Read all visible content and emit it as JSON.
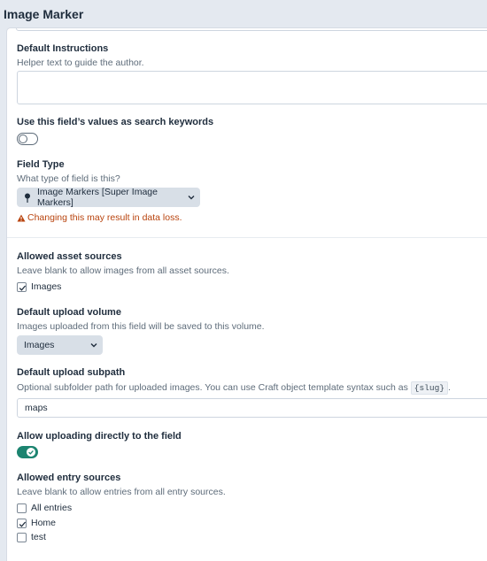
{
  "header": {
    "title": "Image Marker"
  },
  "default_instructions": {
    "label": "Default Instructions",
    "help": "Helper text to guide the author.",
    "value": ""
  },
  "search_keywords": {
    "label": "Use this field’s values as search keywords",
    "enabled": false
  },
  "field_type": {
    "label": "Field Type",
    "help": "What type of field is this?",
    "selected": "Image Markers [Super Image Markers]",
    "warning": "Changing this may result in data loss."
  },
  "asset_sources": {
    "label": "Allowed asset sources",
    "help": "Leave blank to allow images from all asset sources.",
    "options": [
      {
        "label": "Images",
        "checked": true
      }
    ]
  },
  "upload_volume": {
    "label": "Default upload volume",
    "help": "Images uploaded from this field will be saved to this volume.",
    "selected": "Images"
  },
  "upload_subpath": {
    "label": "Default upload subpath",
    "help_prefix": "Optional subfolder path for uploaded images. You can use Craft object template syntax such as",
    "help_code": "{slug}",
    "help_suffix": ".",
    "value": "maps"
  },
  "direct_upload": {
    "label": "Allow uploading directly to the field",
    "enabled": true
  },
  "entry_sources": {
    "label": "Allowed entry sources",
    "help": "Leave blank to allow entries from all entry sources.",
    "options": [
      {
        "label": "All entries",
        "checked": false
      },
      {
        "label": "Home",
        "checked": true
      },
      {
        "label": "test",
        "checked": false
      }
    ]
  },
  "colors": {
    "accent_green": "#1c8470",
    "warning": "#b8430d",
    "select_bg": "#d8dfe7"
  }
}
